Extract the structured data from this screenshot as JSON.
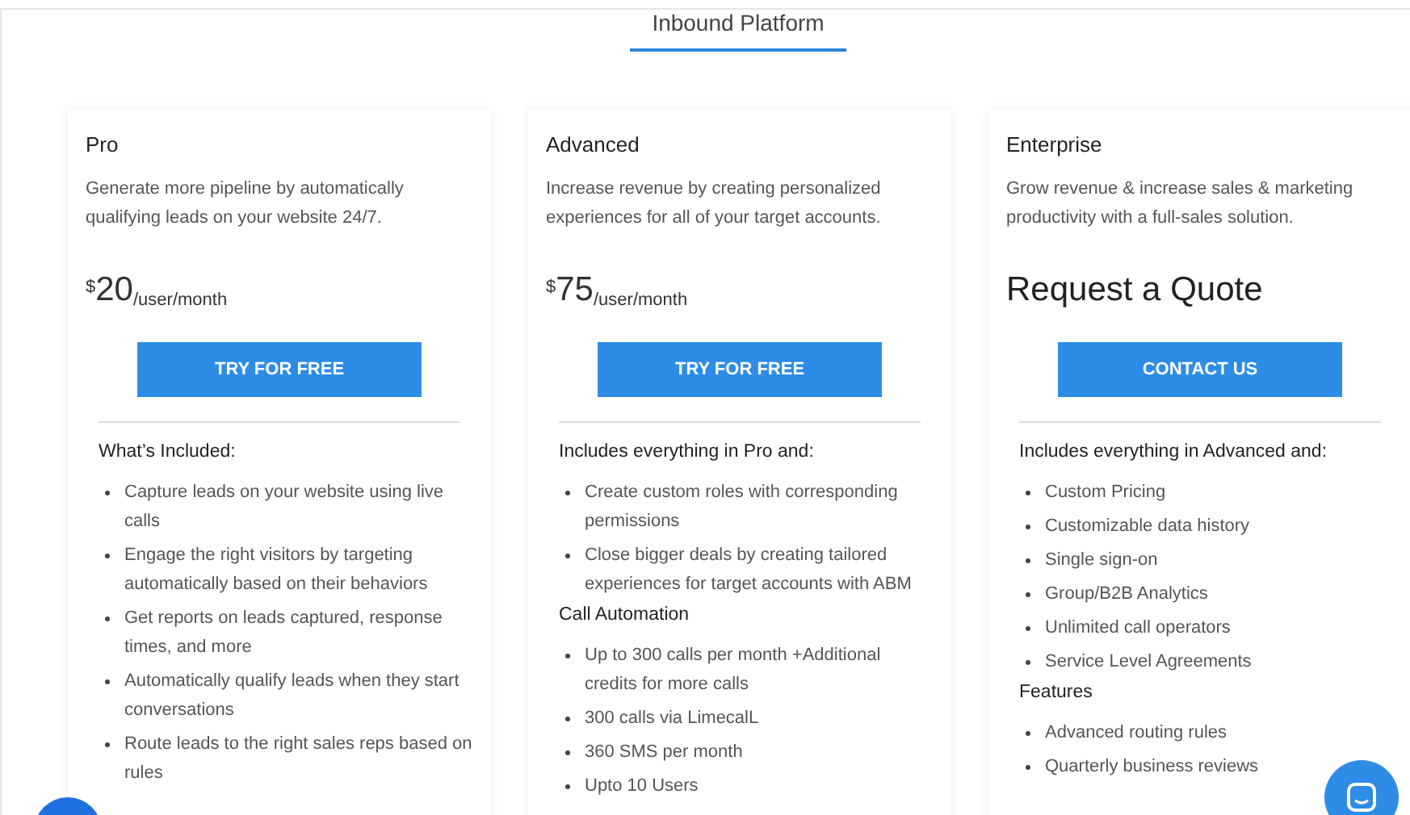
{
  "tabs": [
    {
      "label": "Inbound Platform",
      "selected": true
    }
  ],
  "plans": [
    {
      "name": "Pro",
      "description": "Generate more pipeline by automatically qualifying leads on your website 24/7.",
      "price": {
        "kind": "price",
        "currency": "$",
        "amount": "20",
        "unit": "/user/month"
      },
      "button": "TRY FOR FREE",
      "sections": [
        {
          "heading": "What’s Included:",
          "items": [
            "Capture leads on your website using live calls",
            "Engage the right visitors by targeting automatically based on their behaviors",
            "Get reports on leads captured, response times, and more",
            "Automatically qualify leads when they start conversations",
            "Route leads to the right sales reps based on rules"
          ]
        }
      ]
    },
    {
      "name": "Advanced",
      "description": "Increase revenue by creating personalized experiences for all of your target accounts.",
      "price": {
        "kind": "price",
        "currency": "$",
        "amount": "75",
        "unit": "/user/month"
      },
      "button": "TRY FOR FREE",
      "sections": [
        {
          "heading": "Includes everything in Pro and:",
          "items": [
            "Create custom roles with corresponding permissions",
            "Close bigger deals by creating tailored experiences for target accounts with ABM"
          ]
        },
        {
          "heading": "Call Automation",
          "items": [
            "Up to 300 calls per month +Additional credits for more calls",
            "300 calls via LimecalL",
            "360 SMS per month",
            "Upto 10 Users"
          ]
        }
      ]
    },
    {
      "name": "Enterprise",
      "description": "Grow revenue & increase sales & marketing productivity with a full-sales solution.",
      "price": {
        "kind": "quote",
        "text": "Request a Quote"
      },
      "button": "CONTACT US",
      "sections": [
        {
          "heading": "Includes everything in Advanced and:",
          "items": [
            "Custom Pricing",
            "Customizable data history",
            "Single sign-on",
            "Group/B2B Analytics",
            "Unlimited call operators",
            "Service Level Agreements"
          ]
        },
        {
          "heading": "Features",
          "items": [
            "Advanced routing rules",
            "Quarterly business reviews"
          ]
        }
      ]
    }
  ]
}
